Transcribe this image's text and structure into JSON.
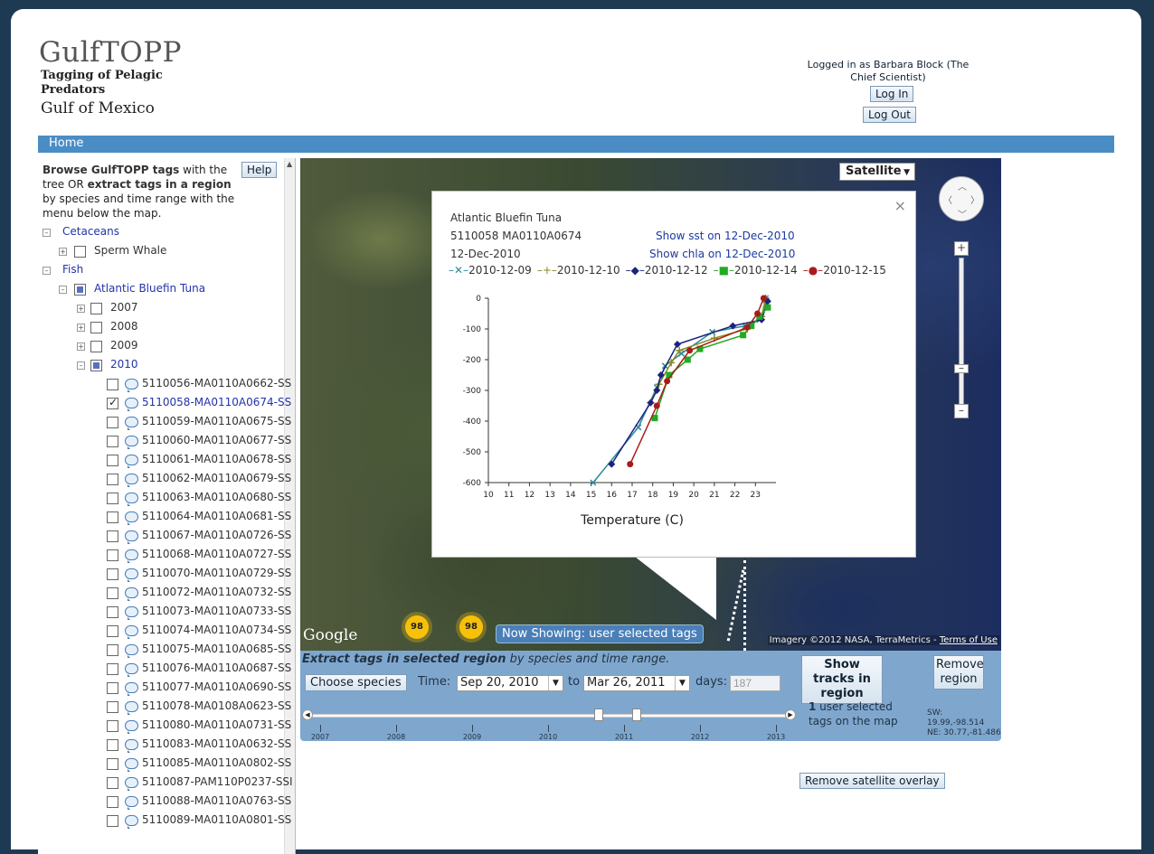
{
  "header": {
    "logo_main": "GulfTOPP",
    "logo_sub1": "Tagging of Pelagic",
    "logo_sub2": "Predators",
    "logo_sub3": "Gulf of Mexico",
    "login_info": "Logged in as Barbara Block (The Chief Scientist)",
    "login_button": "Log In",
    "logout_button": "Log Out"
  },
  "nav": {
    "home": "Home"
  },
  "sidebar": {
    "intro_b1": "Browse GulfTOPP tags",
    "intro_t1": " with the tree OR ",
    "intro_b2": "extract tags in a region",
    "intro_t2": " by species and time range with the menu below the map.",
    "help_button": "Help",
    "tree": {
      "cetaceans": "Cetaceans",
      "sperm_whale": "Sperm Whale",
      "fish": "Fish",
      "bluefin": "Atlantic Bluefin Tuna",
      "years": [
        "2007",
        "2008",
        "2009",
        "2010"
      ],
      "tags": [
        "5110056-MA0110A0662-SS",
        "5110058-MA0110A0674-SS",
        "5110059-MA0110A0675-SS",
        "5110060-MA0110A0677-SS",
        "5110061-MA0110A0678-SS",
        "5110062-MA0110A0679-SS",
        "5110063-MA0110A0680-SS",
        "5110064-MA0110A0681-SS",
        "5110067-MA0110A0726-SS",
        "5110068-MA0110A0727-SS",
        "5110070-MA0110A0729-SS",
        "5110072-MA0110A0732-SS",
        "5110073-MA0110A0733-SS",
        "5110074-MA0110A0734-SS",
        "5110075-MA0110A0685-SS",
        "5110076-MA0110A0687-SS",
        "5110077-MA0110A0690-SS",
        "5110078-MA0108A0623-SS",
        "5110080-MA0110A0731-SS",
        "5110083-MA0110A0632-SS",
        "5110085-MA0110A0802-SS",
        "5110087-PAM110P0237-SSI",
        "5110088-MA0110A0763-SS",
        "5110089-MA0110A0801-SS"
      ],
      "checked_tag_index": 1
    }
  },
  "map": {
    "type_button": "Satellite",
    "google": "Google",
    "imagery": "Imagery ©2012 NASA, TerraMetrics - ",
    "terms": "Terms of Use",
    "cluster1": "98",
    "cluster2": "98",
    "now_showing": "Now Showing: user selected tags"
  },
  "popup": {
    "species": "Atlantic Bluefin Tuna",
    "tag_id": "5110058 MA0110A0674",
    "date": "12-Dec-2010",
    "show_sst": "Show sst on 12-Dec-2010",
    "show_chla": "Show chla on 12-Dec-2010",
    "close": "×"
  },
  "chart_data": {
    "type": "line",
    "xlabel": "Temperature (C)",
    "ylabel": "",
    "xlim": [
      10,
      24
    ],
    "ylim": [
      -600,
      0
    ],
    "xticks": [
      10,
      11,
      12,
      13,
      14,
      15,
      16,
      17,
      18,
      19,
      20,
      21,
      22,
      23
    ],
    "yticks": [
      0,
      -100,
      -200,
      -300,
      -400,
      -500,
      -600
    ],
    "series": [
      {
        "name": "2010-12-09",
        "color": "#2a8a9a",
        "marker": "x",
        "points": [
          [
            15.1,
            -600
          ],
          [
            17.3,
            -420
          ],
          [
            18.2,
            -290
          ],
          [
            18.6,
            -220
          ],
          [
            19.4,
            -180
          ],
          [
            20.9,
            -110
          ],
          [
            22.5,
            -90
          ],
          [
            23.2,
            -70
          ],
          [
            23.5,
            -20
          ],
          [
            23.5,
            0
          ]
        ]
      },
      {
        "name": "2010-12-10",
        "color": "#8a8a20",
        "marker": "+",
        "points": [
          [
            17.9,
            -340
          ],
          [
            18.3,
            -280
          ],
          [
            18.9,
            -210
          ],
          [
            19.3,
            -170
          ],
          [
            21.0,
            -130
          ],
          [
            22.6,
            -100
          ],
          [
            23.3,
            -60
          ],
          [
            23.5,
            0
          ]
        ]
      },
      {
        "name": "2010-12-12",
        "color": "#1a237e",
        "marker": "diamond",
        "points": [
          [
            16.0,
            -540
          ],
          [
            17.9,
            -340
          ],
          [
            18.2,
            -300
          ],
          [
            18.4,
            -250
          ],
          [
            19.2,
            -150
          ],
          [
            21.9,
            -90
          ],
          [
            23.3,
            -70
          ],
          [
            23.6,
            -10
          ]
        ]
      },
      {
        "name": "2010-12-14",
        "color": "#22aa22",
        "marker": "square",
        "points": [
          [
            18.1,
            -390
          ],
          [
            18.8,
            -250
          ],
          [
            19.7,
            -200
          ],
          [
            20.3,
            -165
          ],
          [
            22.4,
            -120
          ],
          [
            22.8,
            -90
          ],
          [
            23.2,
            -60
          ],
          [
            23.6,
            -30
          ]
        ]
      },
      {
        "name": "2010-12-15",
        "color": "#aa1a1a",
        "marker": "circle",
        "points": [
          [
            16.9,
            -540
          ],
          [
            18.2,
            -350
          ],
          [
            18.7,
            -270
          ],
          [
            19.8,
            -170
          ],
          [
            22.6,
            -95
          ],
          [
            23.1,
            -50
          ],
          [
            23.4,
            0
          ]
        ]
      }
    ]
  },
  "controls": {
    "title_bold": "Extract tags in selected region",
    "title_rest": " by species and time range.",
    "choose_species": "Choose species",
    "time_label": "Time:",
    "from_date": "Sep 20, 2010",
    "to_label": "to",
    "to_date": "Mar 26, 2011",
    "days_label": "days:",
    "days_value": "187",
    "show_tracks": "Show tracks in region",
    "remove_region": "Remove region",
    "tags_count": "1",
    "tags_text": " user selected tags on the map",
    "sw": "SW: 19.99,-98.514",
    "ne": "NE: 30.77,-81.486",
    "years": [
      "2007",
      "2008",
      "2009",
      "2010",
      "2011",
      "2012",
      "2013"
    ]
  },
  "footer": {
    "remove_satellite": "Remove satellite overlay"
  }
}
